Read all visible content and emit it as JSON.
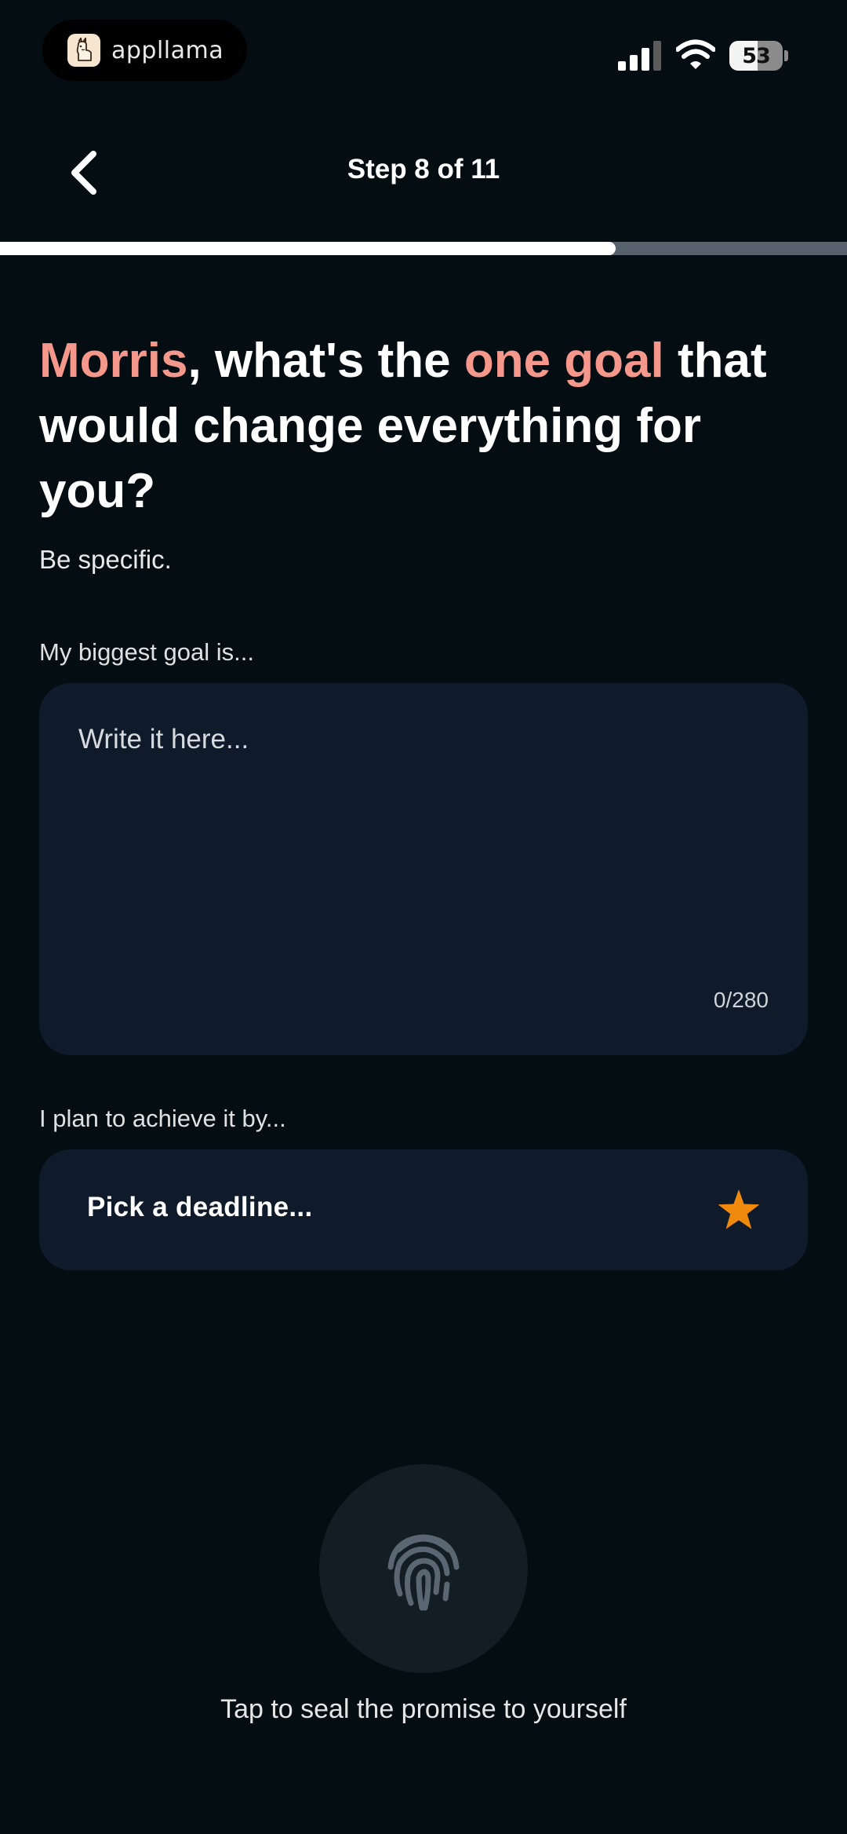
{
  "status_bar": {
    "app_name": "appllama",
    "battery": "53",
    "battery_level": 0.53
  },
  "header": {
    "step_label": "Step 8 of 11",
    "progress": 0.727
  },
  "question": {
    "name": "Morris",
    "text_part1": ", what's the ",
    "highlight": "one goal",
    "text_part2": " that would change everything for you?",
    "subtitle": "Be specific."
  },
  "goal": {
    "label": "My biggest goal is...",
    "placeholder": "Write it here...",
    "value": "",
    "char_count": "0/280"
  },
  "deadline": {
    "label": "I plan to achieve it by...",
    "button_label": "Pick a deadline...",
    "icon": "star-icon",
    "icon_color": "#f08a0c"
  },
  "seal": {
    "caption": "Tap to seal the promise to yourself",
    "icon": "fingerprint-icon"
  },
  "colors": {
    "background": "#030d12",
    "accent": "#f5978b",
    "card": "#0f1b2a"
  }
}
